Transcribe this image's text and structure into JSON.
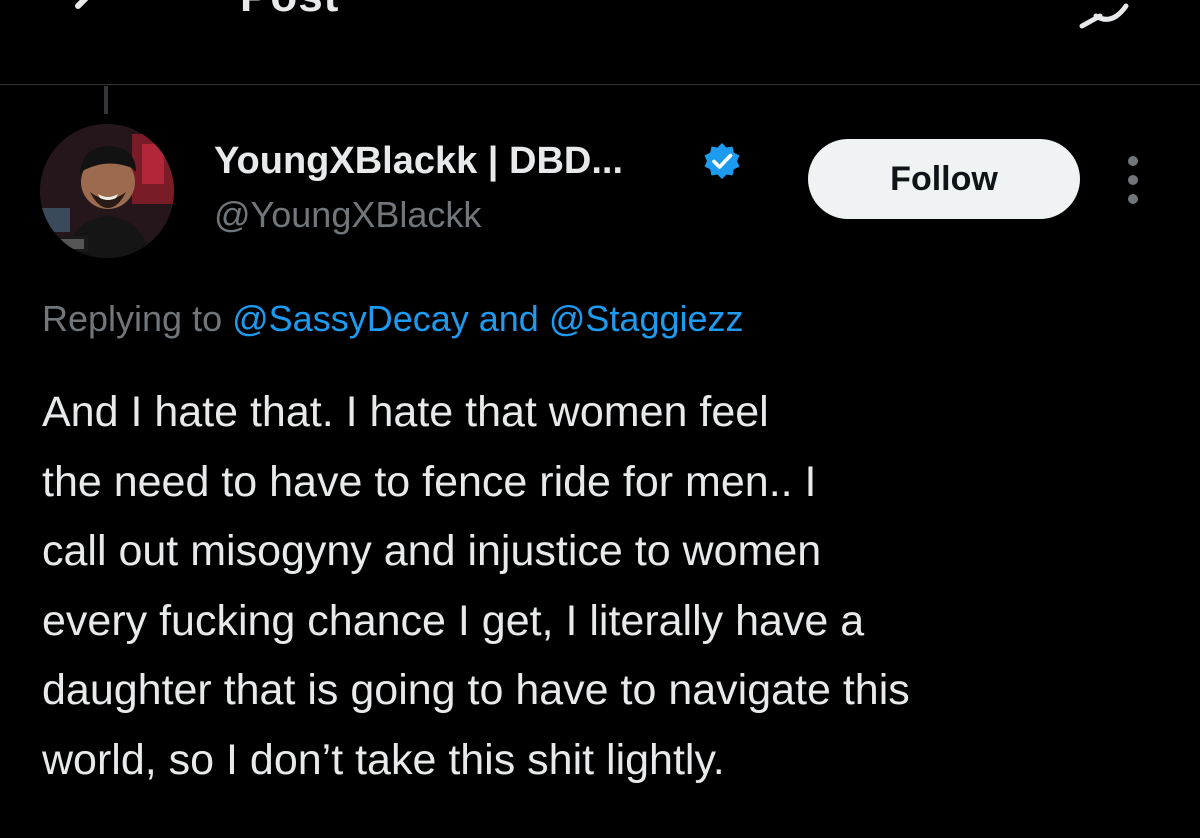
{
  "header": {
    "title": "Post",
    "back_icon": "arrow-left-icon",
    "action_icon": "reply-refresh-icon"
  },
  "author": {
    "name": "YoungXBlackk | DBD...",
    "handle": "@YoungXBlackk",
    "verified": true,
    "verified_icon": "verified-badge-icon",
    "avatar_icon": "user-avatar"
  },
  "follow_button": {
    "label": "Follow"
  },
  "more_menu": {
    "icon": "more-vertical-icon"
  },
  "replying": {
    "prefix": "Replying to",
    "mention_1": "@SassyDecay",
    "conjunction": "and",
    "mention_2": "@Staggiezz"
  },
  "tweet": {
    "lines": [
      "And I hate that. I hate that women feel",
      "the need to have to fence ride for men.. I",
      "call out misogyny and injustice to women",
      "every fucking chance I get, I literally have a",
      "daughter that is going to have to navigate this",
      "world, so I don’t take this shit lightly."
    ]
  },
  "colors": {
    "background": "#000000",
    "text_primary": "#e7e9ea",
    "text_secondary": "#71767b",
    "link": "#1d9bf0",
    "verified": "#1d9bf0",
    "follow_bg": "#eff3f4",
    "follow_text": "#0f1419",
    "divider": "#2f3336"
  }
}
